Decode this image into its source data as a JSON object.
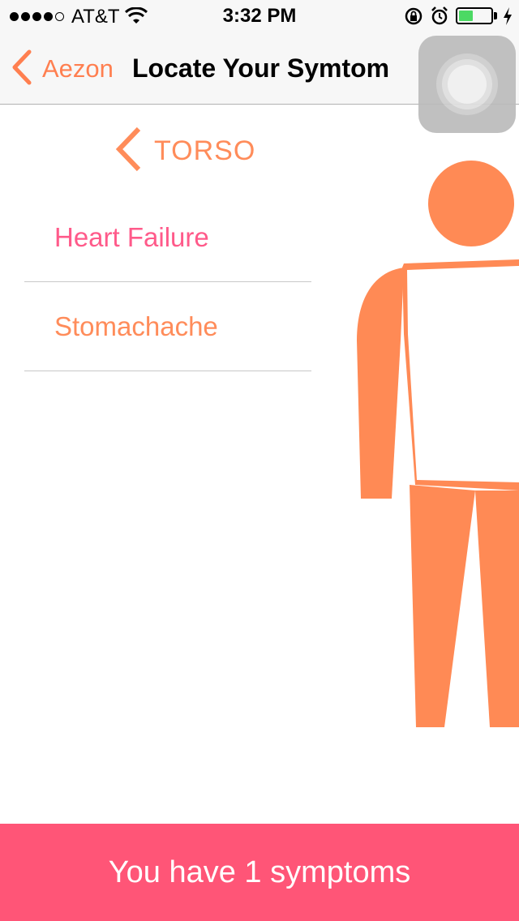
{
  "status_bar": {
    "carrier": "AT&T",
    "time": "3:32 PM",
    "signal_bars_filled": 4,
    "signal_bars_total": 5,
    "battery_level": 0.4
  },
  "nav": {
    "back_label": "Aezon",
    "title": "Locate Your Symtom"
  },
  "region": {
    "label": "TORSO"
  },
  "symptoms": [
    {
      "label": "Heart Failure",
      "color": "#ff5a8a"
    },
    {
      "label": "Stomachache",
      "color": "#ff8c5a"
    }
  ],
  "footer": {
    "text": "You have 1 symptoms"
  },
  "colors": {
    "accent": "#ff7f50",
    "figure": "#ff8a55",
    "footer_bg": "#ff5577"
  }
}
